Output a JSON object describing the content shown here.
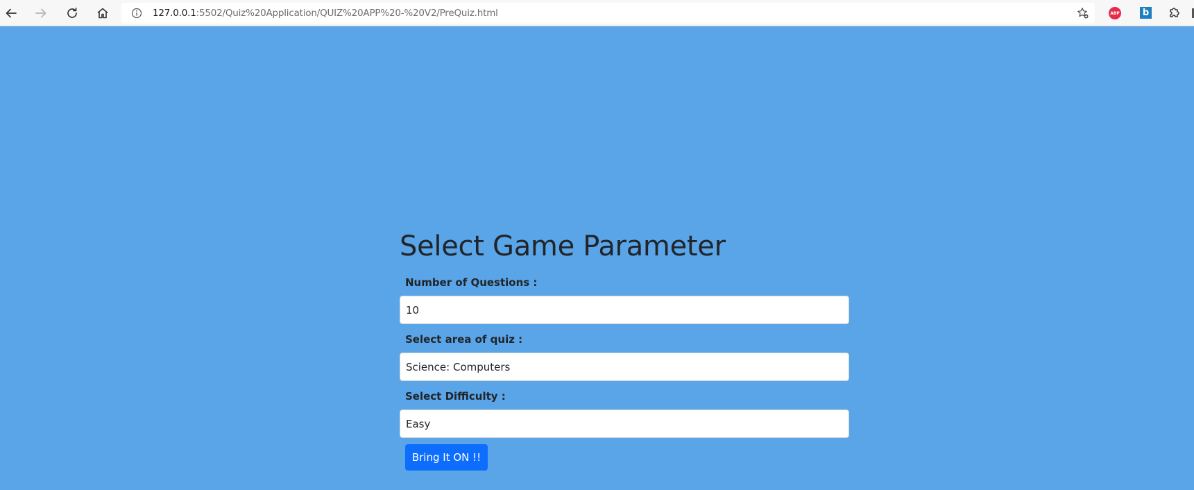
{
  "browser": {
    "address_host": "127.0.0.1",
    "address_path": ":5502/Quiz%20Application/QUIZ%20APP%20-%20V2/PreQuiz.html",
    "extensions": {
      "abp_label": "ABP",
      "b_label": "b"
    }
  },
  "form": {
    "title": "Select Game Parameter",
    "questions_label": "Number of Questions :",
    "questions_value": "10",
    "area_label": "Select area of quiz :",
    "area_value": "Science: Computers",
    "difficulty_label": "Select Difficulty :",
    "difficulty_value": "Easy",
    "submit_label": "Bring It ON !!"
  },
  "colors": {
    "page_background": "#5aa4e8",
    "button_primary": "#0d6efd"
  }
}
